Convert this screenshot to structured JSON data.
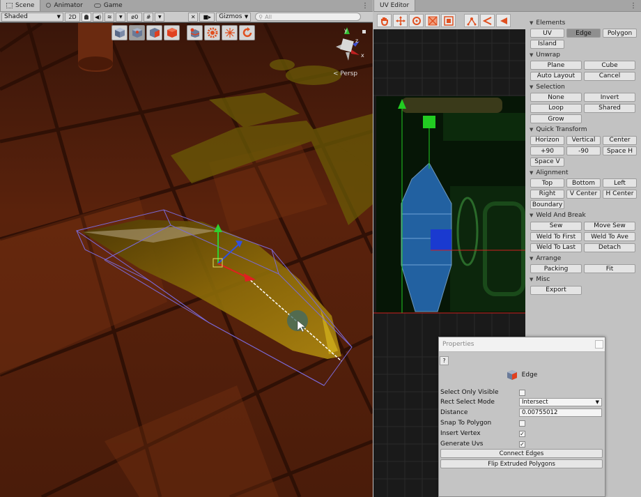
{
  "scene_tabs": [
    {
      "label": "Scene",
      "icon": "grid-icon"
    },
    {
      "label": "Animator",
      "icon": "animator-icon"
    },
    {
      "label": "Game",
      "icon": "gamepad-icon"
    }
  ],
  "scene_toolbar": {
    "shading_mode": "Shaded",
    "mode_2d": "2D",
    "hidden_count": "0",
    "gizmos": "Gizmos",
    "search_placeholder": "All"
  },
  "probuilder_tools": [
    "object-mode-icon",
    "vertex-mode-icon",
    "edge-mode-icon",
    "face-mode-icon",
    "insert-edge-loop-icon",
    "settings-gear-icon",
    "center-pivot-icon",
    "reset-rotation-icon"
  ],
  "viewport": {
    "projection_label": "< Persp",
    "axis_labels": [
      "y",
      "z",
      "x"
    ]
  },
  "uv_editor": {
    "tab": "UV Editor",
    "tools": [
      "hand-icon",
      "move-icon",
      "rotate-icon",
      "scale-icon",
      "rect-icon",
      "vertex-select-icon",
      "edge-select-icon",
      "face-select-icon"
    ]
  },
  "uv_panel": {
    "sections": [
      {
        "title": "Elements",
        "rows": [
          [
            "UV",
            "Edge",
            "Polygon"
          ],
          [
            "Island"
          ]
        ]
      },
      {
        "title": "Unwrap",
        "rows": [
          [
            "Plane",
            "Cube"
          ],
          [
            "Auto Layout",
            "Cancel"
          ]
        ]
      },
      {
        "title": "Selection",
        "rows": [
          [
            "None",
            "Invert"
          ],
          [
            "Loop",
            "Shared"
          ],
          [
            "Grow"
          ]
        ]
      },
      {
        "title": "Quick Transform",
        "rows": [
          [
            "Horizon",
            "Vertical",
            "Center"
          ],
          [
            "+90",
            "-90",
            "Space H"
          ],
          [
            "Space V"
          ]
        ]
      },
      {
        "title": "Alignment",
        "rows": [
          [
            "Top",
            "Bottom",
            "Left"
          ],
          [
            "Right",
            "V Center",
            "H Center"
          ],
          [
            "Boundary"
          ]
        ]
      },
      {
        "title": "Weld And Break",
        "rows": [
          [
            "Sew",
            "Move Sew"
          ],
          [
            "Weld To First",
            "Weld To Ave"
          ],
          [
            "Weld To Last",
            "Detach"
          ]
        ]
      },
      {
        "title": "Arrange",
        "rows": [
          [
            "Packing",
            "Fit"
          ]
        ]
      },
      {
        "title": "Misc",
        "rows": [
          [
            "Export"
          ]
        ]
      }
    ],
    "selected_element": "Edge"
  },
  "properties": {
    "title": "Properties",
    "help": "?",
    "header_label": "Edge",
    "select_only_visible": {
      "label": "Select Only Visible",
      "checked": false
    },
    "rect_select_mode": {
      "label": "Rect Select Mode",
      "value": "Intersect"
    },
    "distance": {
      "label": "Distance",
      "value": "0.00755012"
    },
    "snap_to_polygon": {
      "label": "Snap To Polygon",
      "checked": false
    },
    "insert_vertex": {
      "label": "Insert Vertex",
      "checked": true
    },
    "generate_uvs": {
      "label": "Generate Uvs",
      "checked": true
    },
    "connect_edges": "Connect Edges",
    "flip_extruded": "Flip Extruded Polygons"
  },
  "colors": {
    "floor": "#5a220c",
    "mesh": "#8a6a08",
    "selection": "#7a6ad8",
    "uv_island": "#2a74c8",
    "uv_handle": "#22cc22",
    "uv_line": "#d02020"
  }
}
